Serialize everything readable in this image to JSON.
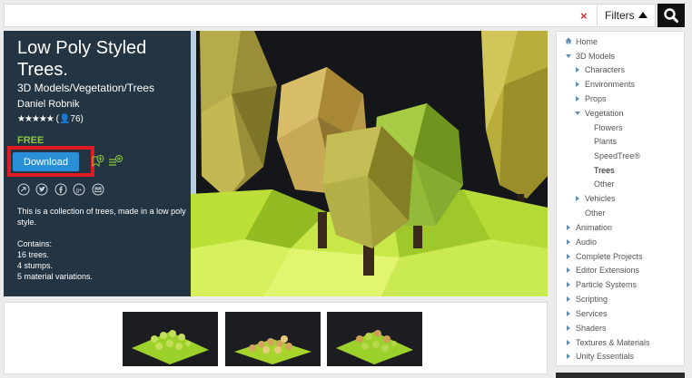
{
  "search": {
    "value": "",
    "clear_glyph": "×",
    "filters_label": "Filters",
    "search_icon": "magnifier-icon"
  },
  "product": {
    "title": "Low Poly Styled Trees.",
    "category_path": "3D Models/Vegetation/Trees",
    "publisher": "Daniel Robnik",
    "stars": "★★★★★",
    "rating_count": "(👤76)",
    "price": "FREE",
    "download_label": "Download",
    "description": "This is a collection of trees, made in a low poly style.",
    "contains_label": "Contains:",
    "contains": [
      "16 trees.",
      "4 stumps.",
      "5 material variations."
    ]
  },
  "colors": {
    "panel_bg": "#233542",
    "price_green": "#8cc63f",
    "download_blue": "#2b8fd8",
    "highlight_red": "#e01b23",
    "tree_arrow": "#5d8fb5"
  },
  "share_icons": [
    "reddit-icon",
    "twitter-icon",
    "facebook-icon",
    "google-plus-icon",
    "email-icon"
  ],
  "tree": {
    "home": "Home",
    "items": [
      {
        "label": "3D Models",
        "expanded": true
      },
      {
        "label": "Characters",
        "expanded": false
      },
      {
        "label": "Environments",
        "expanded": false
      },
      {
        "label": "Props",
        "expanded": false
      },
      {
        "label": "Vegetation",
        "expanded": true
      },
      {
        "label": "Flowers"
      },
      {
        "label": "Plants"
      },
      {
        "label": "SpeedTree®"
      },
      {
        "label": "Trees",
        "active": true
      },
      {
        "label": "Other"
      },
      {
        "label": "Vehicles",
        "expanded": false
      },
      {
        "label": "Other"
      },
      {
        "label": "Animation",
        "expanded": false
      },
      {
        "label": "Audio",
        "expanded": false
      },
      {
        "label": "Complete Projects",
        "expanded": false
      },
      {
        "label": "Editor Extensions",
        "expanded": false
      },
      {
        "label": "Particle Systems",
        "expanded": false
      },
      {
        "label": "Scripting",
        "expanded": false
      },
      {
        "label": "Services",
        "expanded": false
      },
      {
        "label": "Shaders",
        "expanded": false
      },
      {
        "label": "Textures & Materials",
        "expanded": false
      },
      {
        "label": "Unity Essentials",
        "expanded": false
      }
    ]
  }
}
